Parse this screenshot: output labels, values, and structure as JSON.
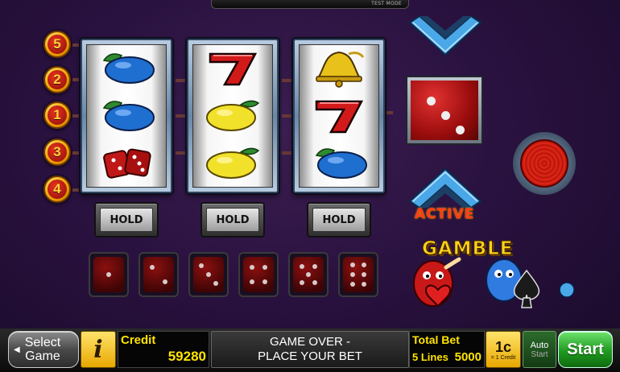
{
  "top_bar": {
    "label": "TEST MODE"
  },
  "paylines": [
    "5",
    "2",
    "1",
    "3",
    "4"
  ],
  "reels": [
    {
      "symbols": [
        "plums",
        "plums",
        "dice"
      ]
    },
    {
      "symbols": [
        "seven",
        "lemon",
        "lemon"
      ]
    },
    {
      "symbols": [
        "bell",
        "seven",
        "plums"
      ]
    }
  ],
  "hold_buttons": [
    "HOLD",
    "HOLD",
    "HOLD"
  ],
  "dice_row": [
    1,
    2,
    3,
    4,
    5,
    6
  ],
  "gamble": {
    "active_label": "ACTIVE",
    "logo_text": "GAMBLE",
    "die_value": 3
  },
  "bottom": {
    "select_game": [
      "Select",
      "Game"
    ],
    "info_label": "i",
    "credit_label": "Credit",
    "credit_value": "59280",
    "message_line1": "GAME OVER -",
    "message_line2": "PLACE YOUR BET",
    "total_bet_label": "Total Bet",
    "lines_label": "5 Lines",
    "total_bet_value": "5000",
    "denom_label": "1c",
    "denom_sub": "= 1 Credit",
    "auto_label": "Auto",
    "auto_sub": "Start",
    "start_label": "Start"
  },
  "colors": {
    "background": "#2a1240",
    "accent_yellow": "#ffe400",
    "start_green": "#1f9a1f",
    "active_red": "#ff3c1a"
  }
}
